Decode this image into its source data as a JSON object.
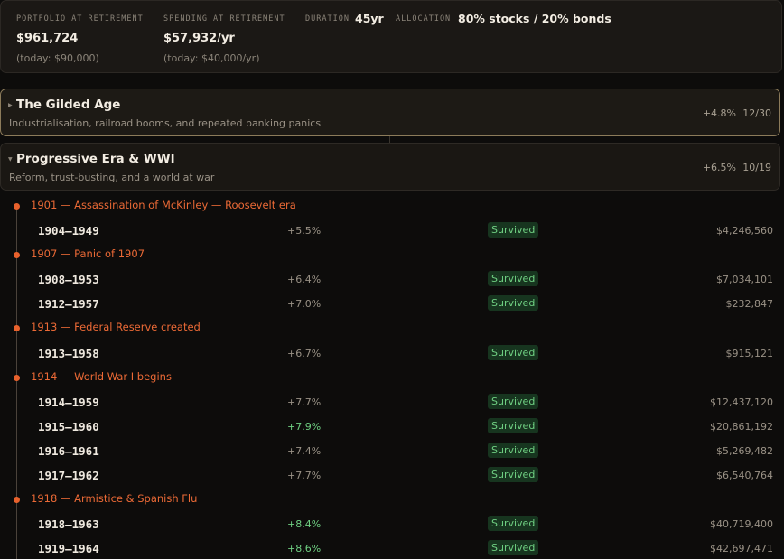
{
  "summary": {
    "portfolio_label": "PORTFOLIO AT RETIREMENT",
    "portfolio_value": "$961,724",
    "portfolio_today": "(today: $90,000)",
    "spending_label": "SPENDING AT RETIREMENT",
    "spending_value": "$57,932/yr",
    "spending_today": "(today: $40,000/yr)",
    "duration_label": "DURATION",
    "duration_value": "45yr",
    "allocation_label": "ALLOCATION",
    "allocation_value": "80% stocks / 20% bonds"
  },
  "eras": [
    {
      "title": "The Gilded Age",
      "description": "Industrialisation, railroad booms, and repeated banking panics",
      "rate": "+4.8%",
      "count": "12/30",
      "expanded": false
    },
    {
      "title": "Progressive Era & WWI",
      "description": "Reform, trust-busting, and a world at war",
      "rate": "+6.5%",
      "count": "10/19",
      "expanded": true
    }
  ],
  "timeline": {
    "events": [
      {
        "label": "1901 — Assassination of McKinley — Roosevelt era"
      },
      {
        "label": "1907 — Panic of 1907"
      },
      {
        "label": "1913 — Federal Reserve created"
      },
      {
        "label": "1914 — World War I begins"
      },
      {
        "label": "1918 — Armistice & Spanish Flu"
      }
    ],
    "rows": [
      {
        "years": "1904–1949",
        "rate": "+5.5%",
        "status": "Survived",
        "value": "$4,246,560"
      },
      {
        "years": "1908–1953",
        "rate": "+6.4%",
        "status": "Survived",
        "value": "$7,034,101"
      },
      {
        "years": "1912–1957",
        "rate": "+7.0%",
        "status": "Survived",
        "value": "$232,847"
      },
      {
        "years": "1913–1958",
        "rate": "+6.7%",
        "status": "Survived",
        "value": "$915,121"
      },
      {
        "years": "1914–1959",
        "rate": "+7.7%",
        "status": "Survived",
        "value": "$12,437,120"
      },
      {
        "years": "1915–1960",
        "rate": "+7.9%",
        "status": "Survived",
        "value": "$20,861,192"
      },
      {
        "years": "1916–1961",
        "rate": "+7.4%",
        "status": "Survived",
        "value": "$5,269,482"
      },
      {
        "years": "1917–1962",
        "rate": "+7.7%",
        "status": "Survived",
        "value": "$6,540,764"
      },
      {
        "years": "1918–1963",
        "rate": "+8.4%",
        "status": "Survived",
        "value": "$40,719,400"
      },
      {
        "years": "1919–1964",
        "rate": "+8.6%",
        "status": "Survived",
        "value": "$42,697,471"
      }
    ]
  },
  "colors": {
    "event_accent": "#e8612c",
    "survived_bg": "#17351f",
    "survived_text": "#6fcf82",
    "gilded_border": "#8c7b5a"
  }
}
